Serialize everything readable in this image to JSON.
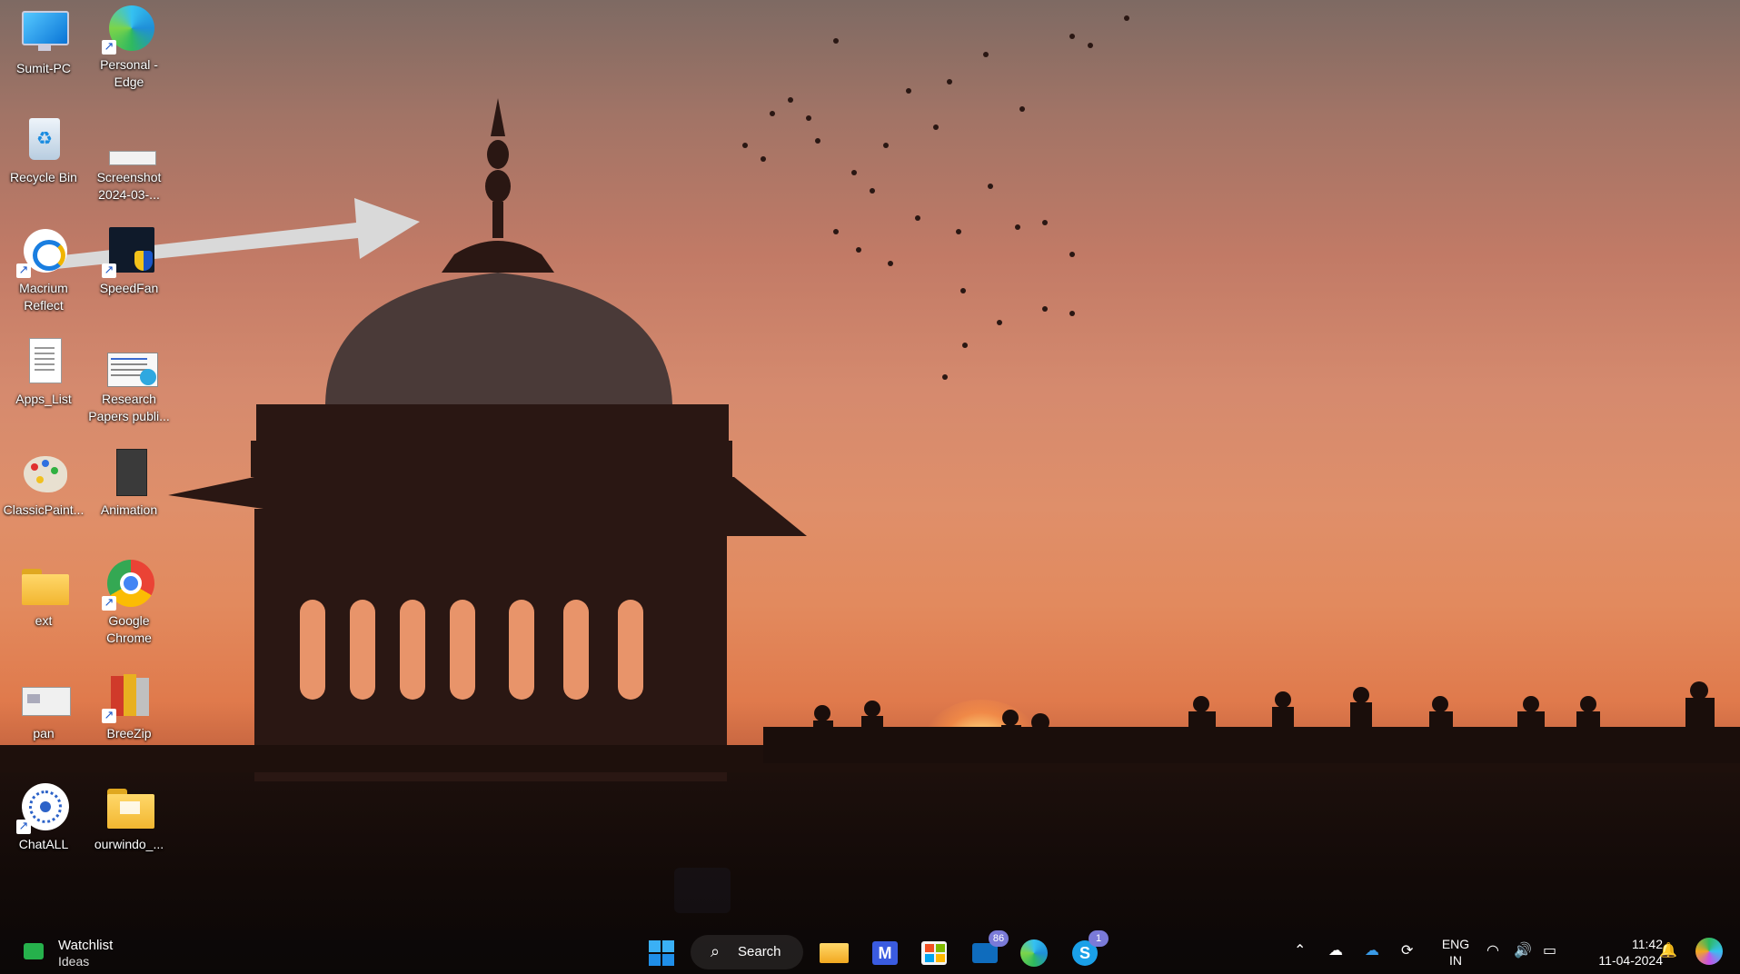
{
  "desktop_icons": [
    {
      "id": "sumit-pc",
      "label": "Sumit-PC",
      "icon": "monitor-icon",
      "shortcut": false
    },
    {
      "id": "edge",
      "label": "Personal - Edge",
      "icon": "edge-icon",
      "shortcut": true
    },
    {
      "id": "recycle-bin",
      "label": "Recycle Bin",
      "icon": "recycle-bin-icon",
      "shortcut": false
    },
    {
      "id": "screenshot",
      "label": "Screenshot 2024-03-...",
      "icon": "image-file-icon",
      "shortcut": false
    },
    {
      "id": "macrium",
      "label": "Macrium Reflect",
      "icon": "macrium-icon",
      "shortcut": true
    },
    {
      "id": "speedfan",
      "label": "SpeedFan",
      "icon": "speedfan-icon",
      "shortcut": true
    },
    {
      "id": "apps-list",
      "label": "Apps_List",
      "icon": "text-file-icon",
      "shortcut": false
    },
    {
      "id": "research",
      "label": "Research Papers publi...",
      "icon": "document-icon",
      "shortcut": false
    },
    {
      "id": "classicpaint",
      "label": "ClassicPaint...",
      "icon": "paint-palette-icon",
      "shortcut": false
    },
    {
      "id": "animation",
      "label": "Animation",
      "icon": "video-file-icon",
      "shortcut": false
    },
    {
      "id": "ext",
      "label": "ext",
      "icon": "folder-icon",
      "shortcut": false
    },
    {
      "id": "chrome",
      "label": "Google Chrome",
      "icon": "chrome-icon",
      "shortcut": true
    },
    {
      "id": "pan",
      "label": "pan",
      "icon": "card-image-icon",
      "shortcut": false
    },
    {
      "id": "breezip",
      "label": "BreeZip",
      "icon": "breezip-icon",
      "shortcut": true
    },
    {
      "id": "chatall",
      "label": "ChatALL",
      "icon": "chatall-icon",
      "shortcut": true
    },
    {
      "id": "ourwindo",
      "label": "ourwindo_...",
      "icon": "folder-icon",
      "shortcut": false
    }
  ],
  "taskbar": {
    "widget": {
      "title": "Watchlist",
      "subtitle": "Ideas"
    },
    "search_label": "Search",
    "apps": [
      {
        "id": "file-explorer",
        "icon": "folder-icon",
        "badge": ""
      },
      {
        "id": "app-m",
        "icon": "app-m-icon",
        "badge": ""
      },
      {
        "id": "store",
        "icon": "store-icon",
        "badge": ""
      },
      {
        "id": "mail",
        "icon": "mail-icon",
        "badge": "86"
      },
      {
        "id": "edge-dev",
        "icon": "edge-dev-icon",
        "badge": ""
      },
      {
        "id": "skype",
        "icon": "skype-icon",
        "badge": "1"
      }
    ],
    "tray": {
      "language": "ENG",
      "region": "IN",
      "time": "11:42",
      "date": "11-04-2024"
    }
  },
  "colors": {
    "accent": "#0f6cbd",
    "sky_top": "#7e6a63",
    "sky_glow": "#e28a5e"
  }
}
